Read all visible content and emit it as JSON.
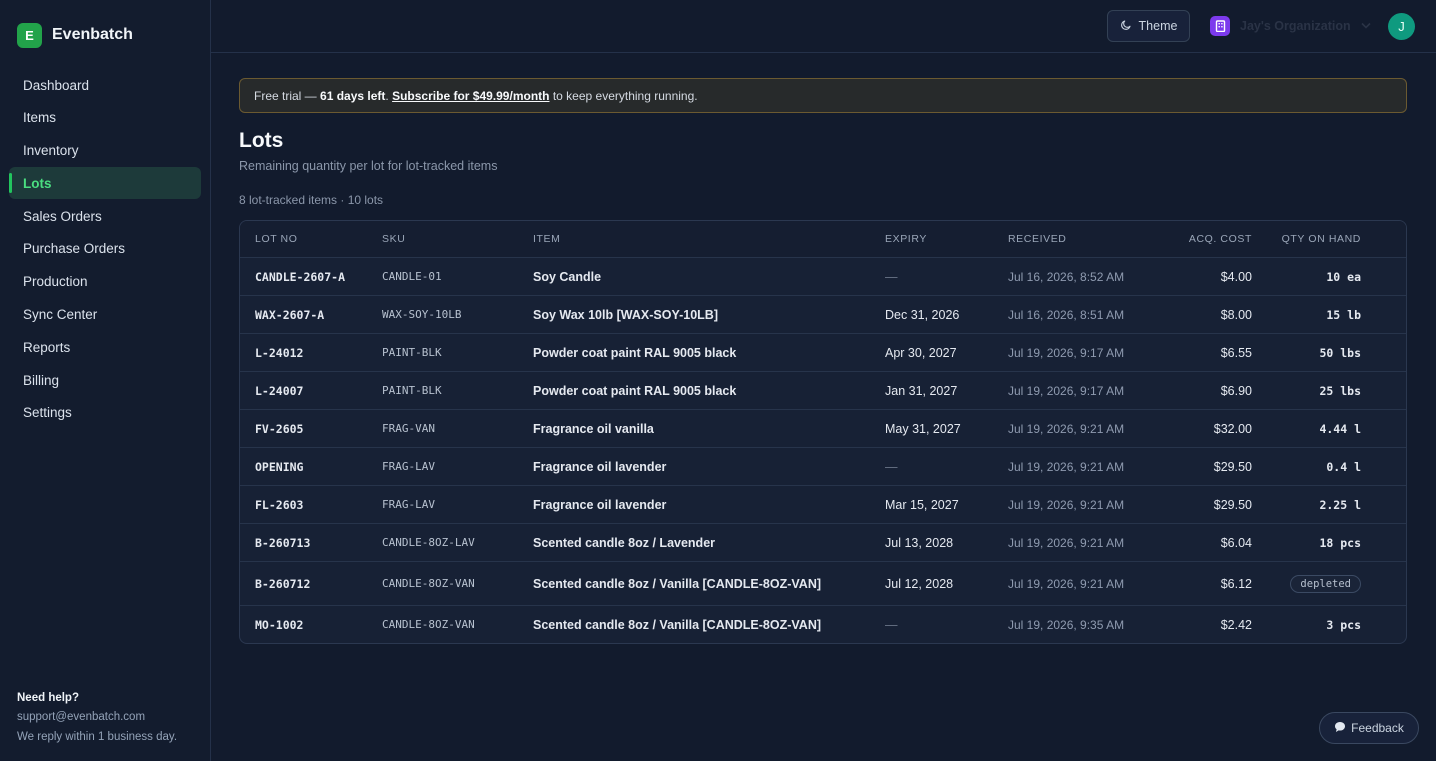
{
  "brand": {
    "logo_letter": "E",
    "name": "Evenbatch",
    "accent": "#22a34a"
  },
  "sidebar": {
    "items": [
      {
        "label": "Dashboard"
      },
      {
        "label": "Items"
      },
      {
        "label": "Inventory"
      },
      {
        "label": "Lots",
        "active": true
      },
      {
        "label": "Sales Orders"
      },
      {
        "label": "Purchase Orders"
      },
      {
        "label": "Production"
      },
      {
        "label": "Sync Center"
      },
      {
        "label": "Reports"
      },
      {
        "label": "Billing"
      },
      {
        "label": "Settings"
      }
    ],
    "help": {
      "title": "Need help?",
      "email": "support@evenbatch.com",
      "note": "We reply within 1 business day."
    }
  },
  "topbar": {
    "theme_label": "Theme",
    "org_name": "Jay's Organization",
    "avatar_letter": "J"
  },
  "banner": {
    "prefix": "Free trial — ",
    "days": "61 days left",
    "dot": ". ",
    "link": "Subscribe for $49.99/month",
    "suffix": " to keep everything running."
  },
  "page": {
    "title": "Lots",
    "subtitle": "Remaining quantity per lot for lot-tracked items",
    "count": "8 lot-tracked items · 10 lots"
  },
  "table": {
    "headers": {
      "lot": "LOT NO",
      "sku": "SKU",
      "item": "ITEM",
      "expiry": "EXPIRY",
      "received": "RECEIVED",
      "cost": "ACQ. COST",
      "qty": "QTY ON HAND"
    },
    "rows": [
      {
        "lot": "CANDLE-2607-A",
        "sku": "CANDLE-01",
        "item": "Soy Candle",
        "expiry": "—",
        "received": "Jul 16, 2026, 8:52 AM",
        "cost": "$4.00",
        "qty": "10 ea"
      },
      {
        "lot": "WAX-2607-A",
        "sku": "WAX-SOY-10LB",
        "item": "Soy Wax 10lb [WAX-SOY-10LB]",
        "expiry": "Dec 31, 2026",
        "received": "Jul 16, 2026, 8:51 AM",
        "cost": "$8.00",
        "qty": "15 lb"
      },
      {
        "lot": "L-24012",
        "sku": "PAINT-BLK",
        "item": "Powder coat paint RAL 9005 black",
        "expiry": "Apr 30, 2027",
        "received": "Jul 19, 2026, 9:17 AM",
        "cost": "$6.55",
        "qty": "50 lbs"
      },
      {
        "lot": "L-24007",
        "sku": "PAINT-BLK",
        "item": "Powder coat paint RAL 9005 black",
        "expiry": "Jan 31, 2027",
        "received": "Jul 19, 2026, 9:17 AM",
        "cost": "$6.90",
        "qty": "25 lbs"
      },
      {
        "lot": "FV-2605",
        "sku": "FRAG-VAN",
        "item": "Fragrance oil vanilla",
        "expiry": "May 31, 2027",
        "received": "Jul 19, 2026, 9:21 AM",
        "cost": "$32.00",
        "qty": "4.44 l"
      },
      {
        "lot": "OPENING",
        "sku": "FRAG-LAV",
        "item": "Fragrance oil lavender",
        "expiry": "—",
        "received": "Jul 19, 2026, 9:21 AM",
        "cost": "$29.50",
        "qty": "0.4 l"
      },
      {
        "lot": "FL-2603",
        "sku": "FRAG-LAV",
        "item": "Fragrance oil lavender",
        "expiry": "Mar 15, 2027",
        "received": "Jul 19, 2026, 9:21 AM",
        "cost": "$29.50",
        "qty": "2.25 l"
      },
      {
        "lot": "B-260713",
        "sku": "CANDLE-8OZ-LAV",
        "item": "Scented candle 8oz / Lavender",
        "expiry": "Jul 13, 2028",
        "received": "Jul 19, 2026, 9:21 AM",
        "cost": "$6.04",
        "qty": "18 pcs"
      },
      {
        "lot": "B-260712",
        "sku": "CANDLE-8OZ-VAN",
        "item": "Scented candle 8oz / Vanilla [CANDLE-8OZ-VAN]",
        "expiry": "Jul 12, 2028",
        "received": "Jul 19, 2026, 9:21 AM",
        "cost": "$6.12",
        "qty": "depleted",
        "depleted": true
      },
      {
        "lot": "MO-1002",
        "sku": "CANDLE-8OZ-VAN",
        "item": "Scented candle 8oz / Vanilla [CANDLE-8OZ-VAN]",
        "expiry": "—",
        "received": "Jul 19, 2026, 9:35 AM",
        "cost": "$2.42",
        "qty": "3 pcs"
      }
    ]
  },
  "feedback": {
    "label": "Feedback"
  }
}
